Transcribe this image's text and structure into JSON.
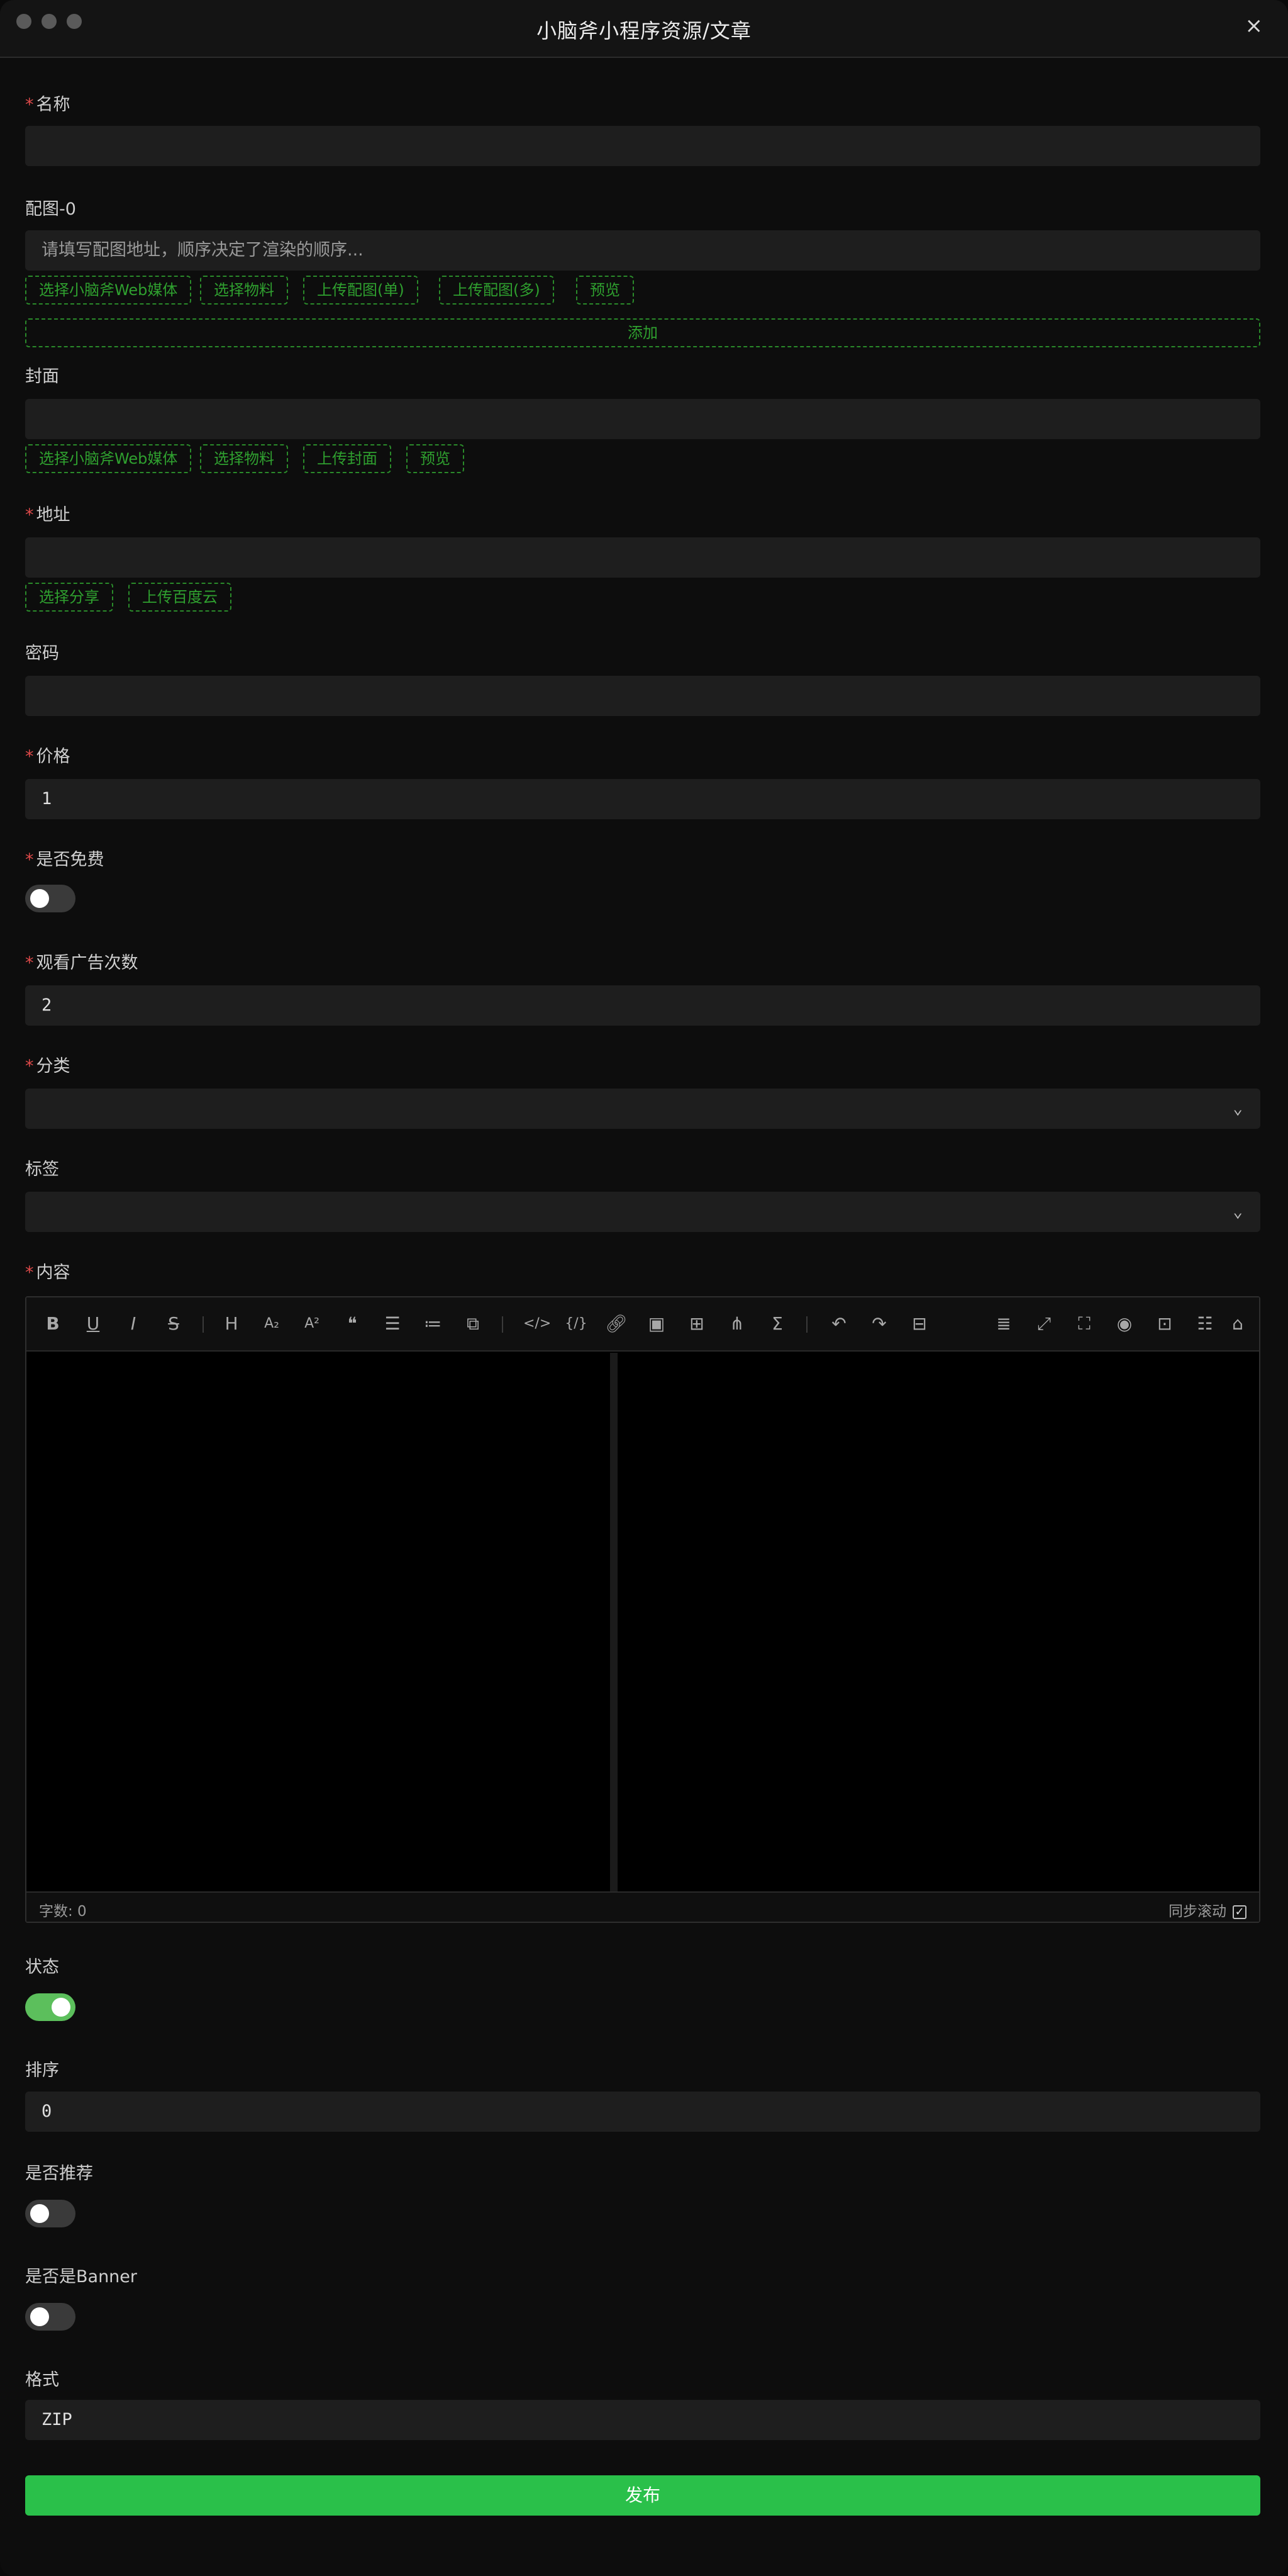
{
  "window": {
    "title": "小脑斧小程序资源/文章",
    "close_icon": "×"
  },
  "fields": {
    "name": {
      "label": "名称",
      "value": ""
    },
    "images": {
      "label": "配图-0",
      "placeholder": "请填写配图地址，顺序决定了渲染的顺序...",
      "buttons": [
        "选择小脑斧Web媒体",
        "选择物料",
        "上传配图(单)",
        "上传配图(多)",
        "预览"
      ],
      "add_label": "添加"
    },
    "cover": {
      "label": "封面",
      "value": "",
      "buttons": [
        "选择小脑斧Web媒体",
        "选择物料",
        "上传封面",
        "预览"
      ]
    },
    "address": {
      "label": "地址",
      "value": "",
      "buttons": [
        "选择分享",
        "上传百度云"
      ]
    },
    "password": {
      "label": "密码",
      "value": ""
    },
    "price": {
      "label": "价格",
      "value": "1"
    },
    "is_free": {
      "label": "是否免费",
      "checked": false
    },
    "ad_views": {
      "label": "观看广告次数",
      "value": "2"
    },
    "category": {
      "label": "分类",
      "value": ""
    },
    "tags": {
      "label": "标签",
      "value": ""
    },
    "content": {
      "label": "内容",
      "word_count": "字数: 0",
      "sync_scroll": "同步滚动",
      "sync_checked": true
    },
    "status": {
      "label": "状态",
      "checked": true
    },
    "sort": {
      "label": "排序",
      "value": "0"
    },
    "recommended": {
      "label": "是否推荐",
      "checked": false
    },
    "banner": {
      "label": "是否是Banner",
      "checked": false
    },
    "format": {
      "label": "格式",
      "value": "ZIP"
    }
  },
  "toolbar": {
    "icons": [
      "bold-icon",
      "underline-icon",
      "italic-icon",
      "strikethrough-icon",
      "heading-icon",
      "subscript-icon",
      "superscript-icon",
      "quote-icon",
      "unordered-list-icon",
      "ordered-list-icon",
      "task-icon",
      "code-icon",
      "code-block-icon",
      "link-icon",
      "image-icon",
      "table-icon",
      "diagram-icon",
      "formula-icon",
      "undo-icon",
      "redo-icon",
      "save-icon",
      "catalog-icon",
      "fullscreen-icon",
      "page-fullscreen-icon",
      "preview-icon",
      "html-preview-icon",
      "markdown-icon",
      "github-icon"
    ]
  },
  "publish_label": "发布"
}
